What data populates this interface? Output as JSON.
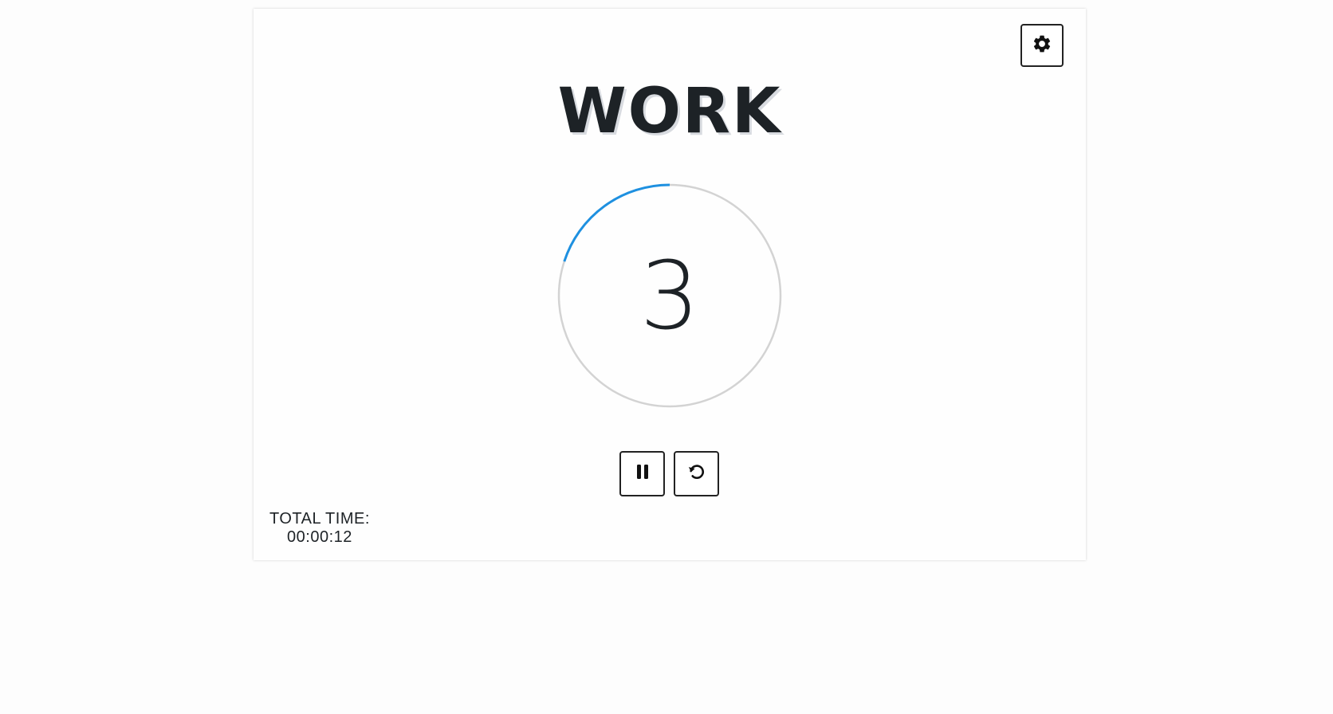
{
  "header": {
    "settings_icon": "gear-icon"
  },
  "timer": {
    "phase": "WORK",
    "countdown": "3",
    "progress_fraction": 0.2,
    "progress_color": "#1e90e0",
    "track_color": "#d3d3d3"
  },
  "controls": {
    "pause_icon": "pause-icon",
    "reset_icon": "reset-icon"
  },
  "total": {
    "label": "TOTAL TIME:",
    "value": "00:00:12"
  }
}
